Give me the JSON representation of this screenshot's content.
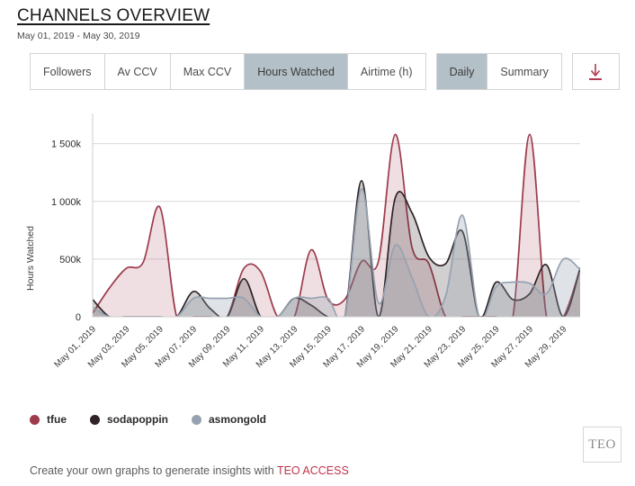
{
  "header": {
    "title": "CHANNELS OVERVIEW",
    "date_range": "May 01, 2019 - May 30, 2019"
  },
  "tabs": {
    "metric_group": [
      {
        "label": "Followers",
        "selected": false
      },
      {
        "label": "Av CCV",
        "selected": false
      },
      {
        "label": "Max CCV",
        "selected": false
      },
      {
        "label": "Hours Watched",
        "selected": true
      },
      {
        "label": "Airtime (h)",
        "selected": false
      }
    ],
    "view_group": [
      {
        "label": "Daily",
        "selected": true
      },
      {
        "label": "Summary",
        "selected": false
      }
    ],
    "download": {
      "icon": "download-arrow-icon",
      "color": "#b03a50"
    }
  },
  "legend": [
    {
      "label": "tfue",
      "color": "#9d3b4d"
    },
    {
      "label": "sodapoppin",
      "color": "#2e2326"
    },
    {
      "label": "asmongold",
      "color": "#96a2b1"
    }
  ],
  "footer": {
    "text_prefix": "Create your own graphs to generate insights with ",
    "link": "TEO ACCESS",
    "logo": "TEO"
  },
  "chart_data": {
    "type": "area",
    "title": "",
    "xlabel": "",
    "ylabel": "Hours Watched",
    "ylim": [
      0,
      1700000
    ],
    "yticks": [
      0,
      500000,
      1000000,
      1500000
    ],
    "ytick_labels": [
      "0",
      "500k",
      "1 000k",
      "1 500k"
    ],
    "grid": true,
    "legend_position": "bottom-left",
    "x": [
      "May 01, 2019",
      "May 02, 2019",
      "May 03, 2019",
      "May 04, 2019",
      "May 05, 2019",
      "May 06, 2019",
      "May 07, 2019",
      "May 08, 2019",
      "May 09, 2019",
      "May 10, 2019",
      "May 11, 2019",
      "May 12, 2019",
      "May 13, 2019",
      "May 14, 2019",
      "May 15, 2019",
      "May 16, 2019",
      "May 17, 2019",
      "May 18, 2019",
      "May 19, 2019",
      "May 20, 2019",
      "May 21, 2019",
      "May 22, 2019",
      "May 23, 2019",
      "May 24, 2019",
      "May 25, 2019",
      "May 26, 2019",
      "May 27, 2019",
      "May 28, 2019",
      "May 29, 2019",
      "May 30, 2019"
    ],
    "xtick_labels": [
      "May 01, 2019",
      "May 03, 2019",
      "May 05, 2019",
      "May 07, 2019",
      "May 09, 2019",
      "May 11, 2019",
      "May 13, 2019",
      "May 15, 2019",
      "May 17, 2019",
      "May 19, 2019",
      "May 21, 2019",
      "May 23, 2019",
      "May 25, 2019",
      "May 27, 2019",
      "May 29, 2019"
    ],
    "xtick_rotation": -45,
    "series": [
      {
        "name": "tfue",
        "color": "#9d3b4d",
        "fill": "rgba(157,59,77,0.16)",
        "values": [
          30000,
          250000,
          420000,
          470000,
          950000,
          0,
          0,
          0,
          0,
          420000,
          390000,
          0,
          0,
          580000,
          150000,
          150000,
          480000,
          480000,
          1580000,
          600000,
          460000,
          0,
          0,
          0,
          0,
          0,
          1580000,
          0,
          0,
          420000
        ]
      },
      {
        "name": "sodapoppin",
        "color": "#2e2326",
        "fill": "rgba(46,35,38,0.22)",
        "values": [
          150000,
          0,
          0,
          0,
          0,
          0,
          220000,
          70000,
          0,
          330000,
          0,
          0,
          160000,
          100000,
          0,
          0,
          1180000,
          0,
          1030000,
          900000,
          520000,
          460000,
          740000,
          0,
          300000,
          150000,
          200000,
          450000,
          0,
          420000
        ]
      },
      {
        "name": "asmongold",
        "color": "#96a2b1",
        "fill": "rgba(150,162,177,0.30)",
        "values": [
          80000,
          0,
          0,
          0,
          0,
          0,
          160000,
          160000,
          160000,
          160000,
          0,
          0,
          160000,
          160000,
          160000,
          0,
          1110000,
          120000,
          620000,
          340000,
          0,
          180000,
          880000,
          0,
          260000,
          300000,
          290000,
          200000,
          500000,
          410000
        ]
      }
    ]
  }
}
